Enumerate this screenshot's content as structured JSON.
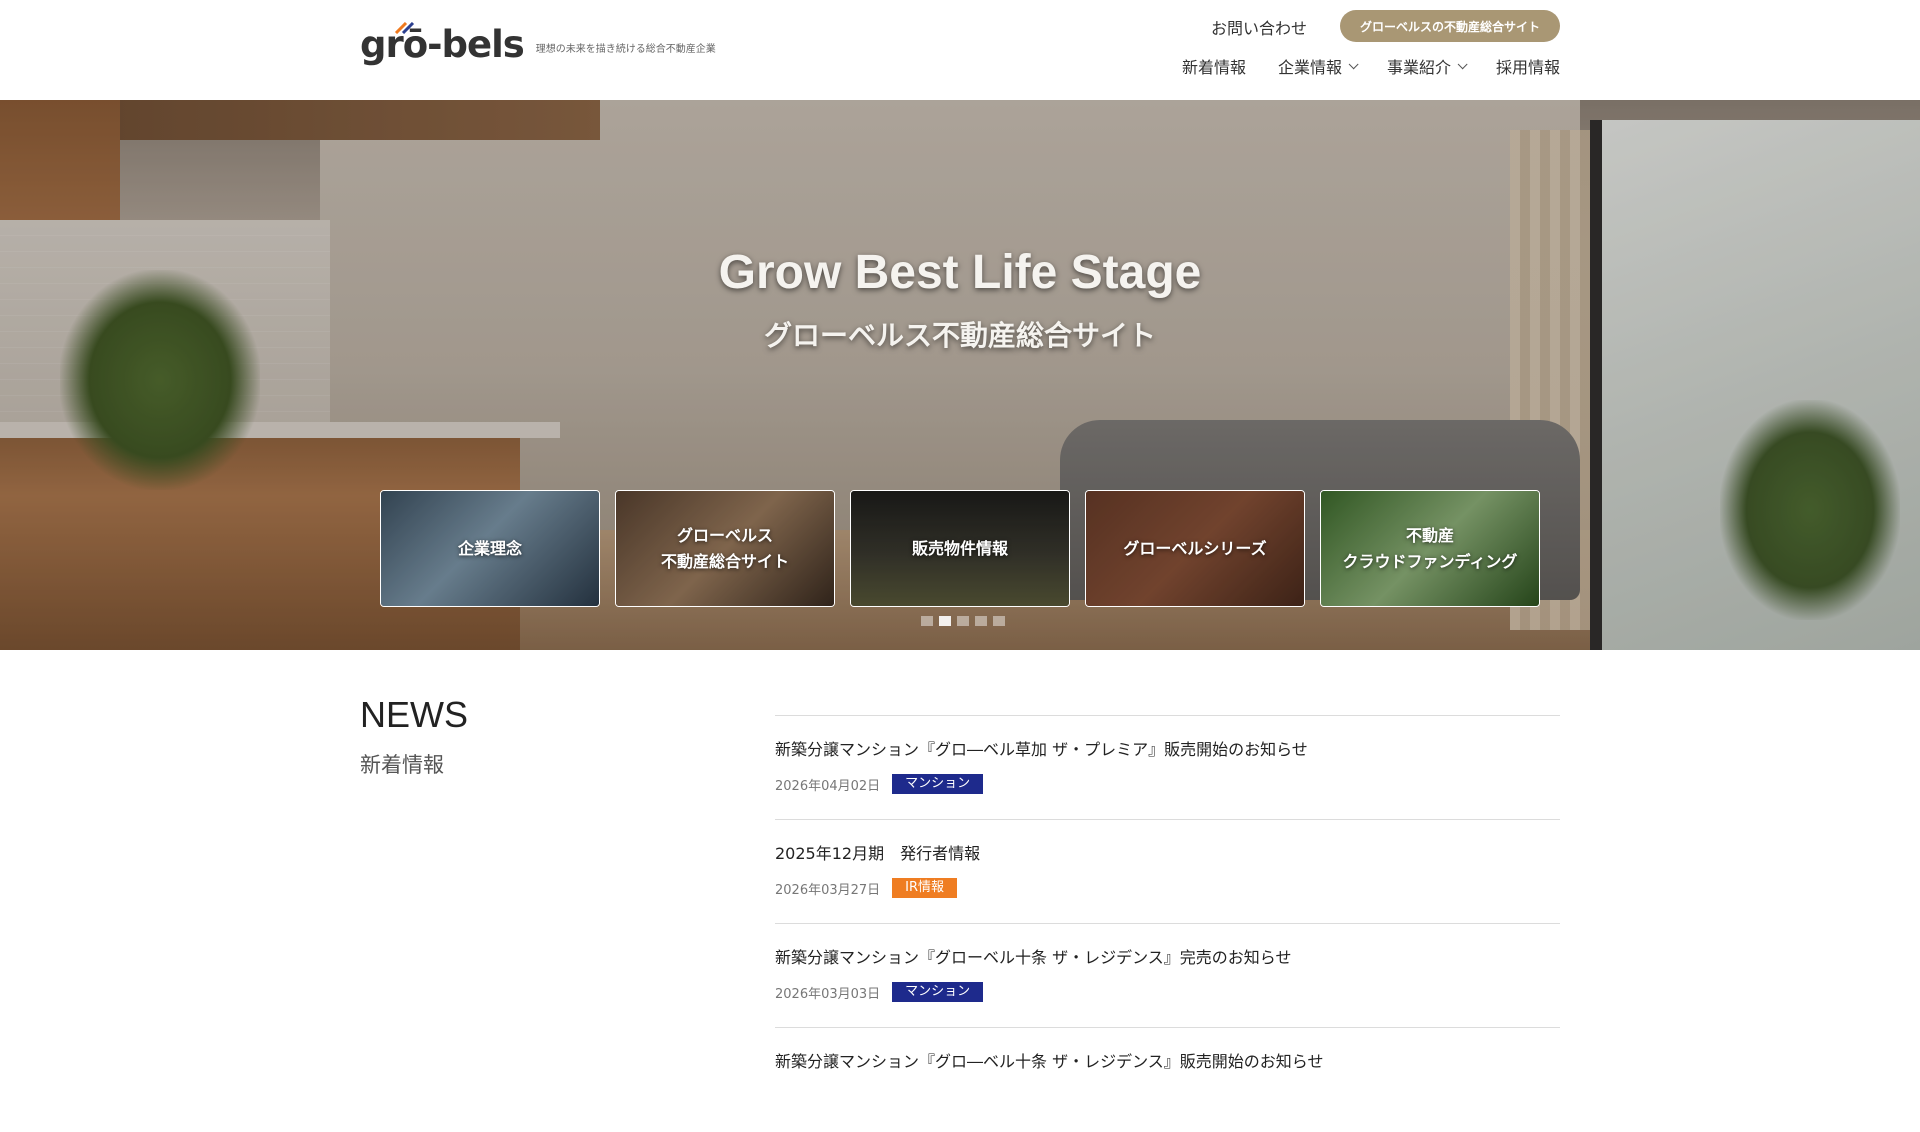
{
  "header": {
    "logo_text": "grō-bels",
    "tagline": "理想の未来を描き続ける総合不動産企業",
    "contact_label": "お問い合わせ",
    "portal_button_label": "グローベルスの不動産総合サイト",
    "nav": [
      {
        "label": "新着情報",
        "has_dropdown": false
      },
      {
        "label": "企業情報",
        "has_dropdown": true
      },
      {
        "label": "事業紹介",
        "has_dropdown": true
      },
      {
        "label": "採用情報",
        "has_dropdown": false
      }
    ]
  },
  "hero": {
    "title": "Grow Best Life Stage",
    "subtitle": "グローベルス不動産総合サイト",
    "cards": [
      {
        "label": "企業理念"
      },
      {
        "label": "グローベルス\n不動産総合サイト"
      },
      {
        "label": "販売物件情報"
      },
      {
        "label": "グローベルシリーズ"
      },
      {
        "label": "不動産\nクラウドファンディング"
      }
    ],
    "slide_count": 5,
    "active_slide": 2
  },
  "news": {
    "heading_en": "NEWS",
    "heading_ja": "新着情報",
    "items": [
      {
        "title": "新築分譲マンション『グロ―ベル草加 ザ・プレミア』販売開始のお知らせ",
        "date": "2026年04月02日",
        "tag": "マンション",
        "tag_color": "#1e2a8c"
      },
      {
        "title": "2025年12月期　発行者情報",
        "date": "2026年03月27日",
        "tag": "IR情報",
        "tag_color": "#ef7d22"
      },
      {
        "title": "新築分譲マンション『グローベル十条 ザ・レジデンス』完売のお知らせ",
        "date": "2026年03月03日",
        "tag": "マンション",
        "tag_color": "#1e2a8c"
      },
      {
        "title": "新築分譲マンション『グロ―ベル十条 ザ・レジデンス』販売開始のお知らせ",
        "date": "",
        "tag": "",
        "tag_color": "#1e2a8c"
      }
    ]
  },
  "colors": {
    "accent_gold": "#a99774",
    "tag_mansion": "#1e2a8c",
    "tag_ir": "#ef7d22"
  }
}
